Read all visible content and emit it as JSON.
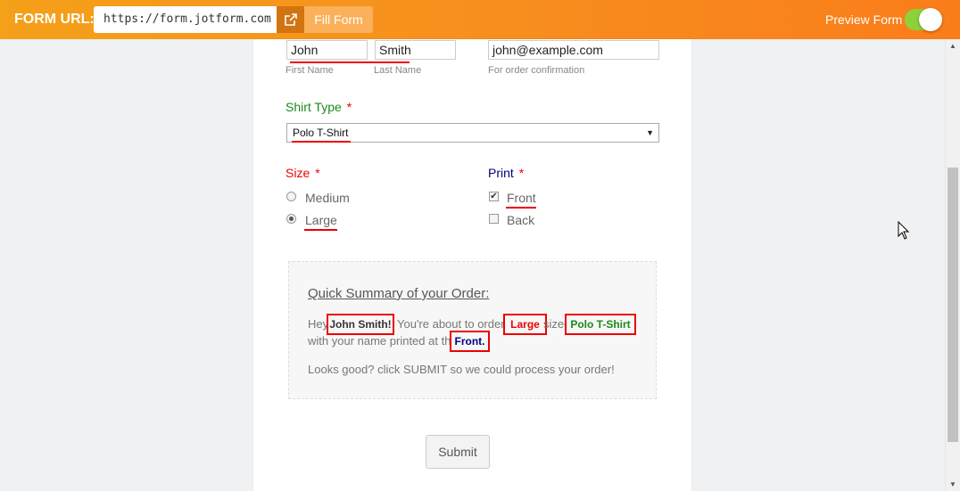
{
  "topbar": {
    "form_url_label": "FORM URL:",
    "url_value": "https://form.jotform.com",
    "open_icon": "external-link-icon",
    "fill_form_label": "Fill Form",
    "preview_label": "Preview Form",
    "preview_enabled": true
  },
  "form": {
    "first_name_value": "John",
    "last_name_value": "Smith",
    "email_value": "john@example.com",
    "first_name_sub": "First Name",
    "last_name_sub": "Last Name",
    "email_sub": "For order confirmation",
    "shirt_type_label": "Shirt Type",
    "shirt_type_value": "Polo T-Shirt",
    "required_mark": "*",
    "size_label": "Size",
    "size_options": [
      "Medium",
      "Large"
    ],
    "size_selected": "Large",
    "print_label": "Print",
    "print_options": [
      "Front",
      "Back"
    ],
    "print_checked": [
      "Front"
    ]
  },
  "summary": {
    "title": "Quick Summary of your Order:",
    "line1_a": "Hey",
    "line1_name": "John Smith!",
    "line1_b": "You're about to order a",
    "line1_size": "Large",
    "line1_c": "sized",
    "line1_shirt": "Polo T-Shirt",
    "line2_a": "with your name printed at the",
    "line2_print": "Front.",
    "line3": "Looks good? click SUBMIT so we could process your order!"
  },
  "submit_label": "Submit",
  "colors": {
    "accent_orange": "#f78f1e",
    "toggle_green": "#8dd13a",
    "label_green": "#1a8a1a",
    "label_red": "#e00000",
    "label_navy": "#000080",
    "highlight_red": "#e00000"
  }
}
